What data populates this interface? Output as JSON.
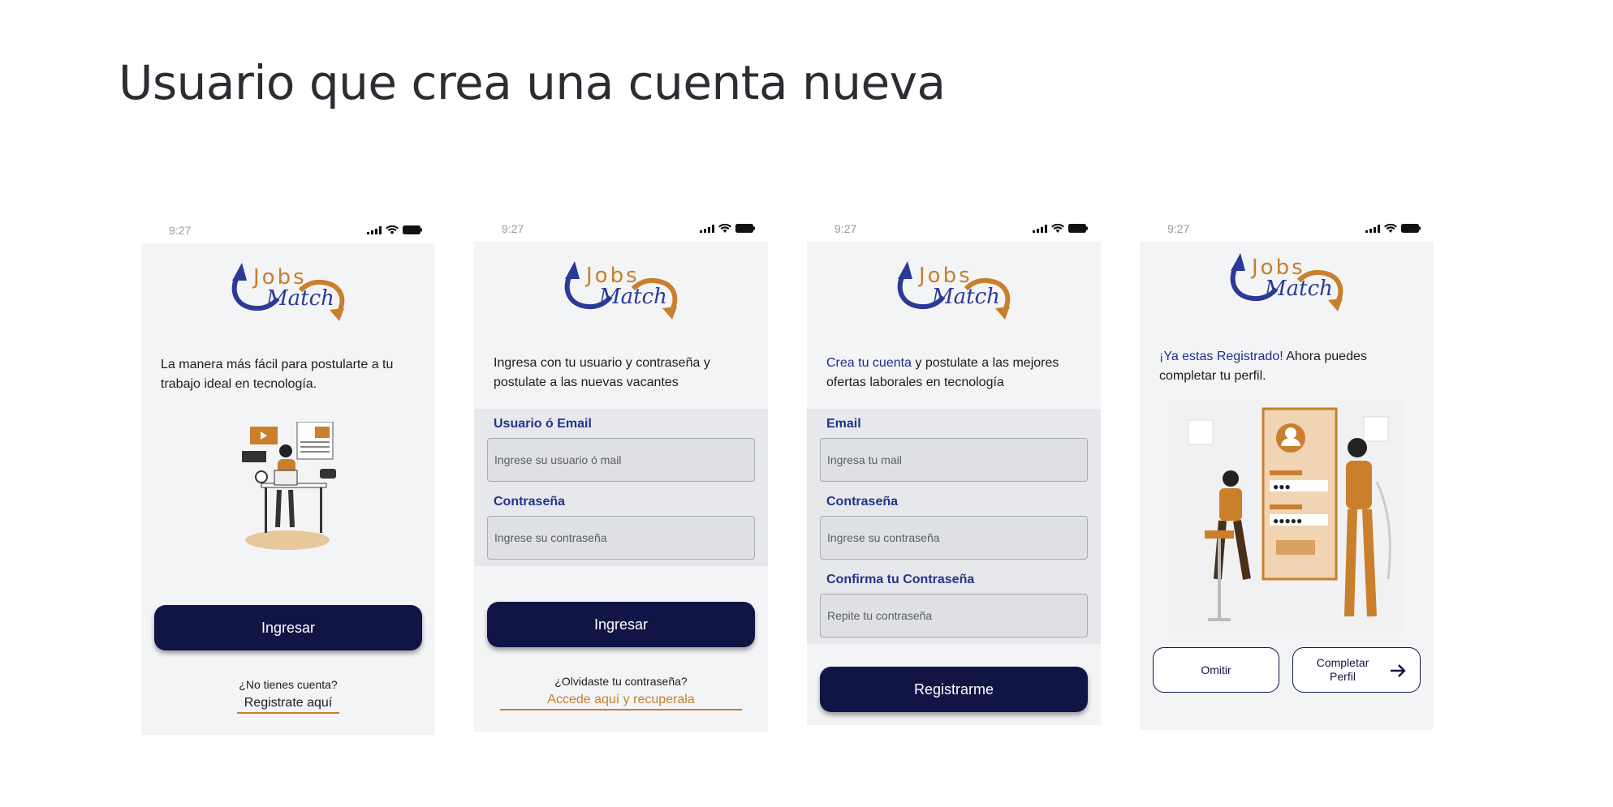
{
  "page": {
    "title": "Usuario que crea una cuenta nueva"
  },
  "screens": [
    {
      "time": "9:27",
      "intro": "La manera más fácil para postularte a tu trabajo ideal en tecnología.",
      "primary_button": "Ingresar",
      "question": "¿No tienes cuenta?",
      "link": "Registrate aquí"
    },
    {
      "time": "9:27",
      "intro": "Ingresa con tu usuario y contraseña y postulate a las nuevas vacantes",
      "fields": [
        {
          "label": "Usuario ó Email",
          "placeholder": "Ingrese su usuario ó mail"
        },
        {
          "label": "Contraseña",
          "placeholder": "Ingrese su contraseña"
        }
      ],
      "primary_button": "Ingresar",
      "question": "¿Olvidaste tu contraseña?",
      "link": "Accede aquí y recuperala"
    },
    {
      "time": "9:27",
      "intro_highlight": "Crea tu cuenta",
      "intro_rest": " y postulate a las mejores ofertas laborales en tecnología",
      "fields": [
        {
          "label": "Email",
          "placeholder": "Ingresa tu mail"
        },
        {
          "label": "Contraseña",
          "placeholder": "Ingrese su contraseña"
        },
        {
          "label": "Confirma tu Contraseña",
          "placeholder": "Repite tu contraseña"
        }
      ],
      "primary_button": "Registrarme"
    },
    {
      "time": "9:27",
      "intro_highlight": "¡Ya estas Registrado!",
      "intro_rest": " Ahora puedes completar tu perfil.",
      "skip_button": "Omitir",
      "complete_button": "Completar Perfil"
    }
  ],
  "logo": {
    "word1": "Jobs",
    "word2": "Match"
  },
  "colors": {
    "navy": "#111545",
    "accent": "#c97f2c",
    "blue": "#26338a",
    "screen_bg": "#f3f4f6"
  },
  "icons": [
    "signal-icon",
    "wifi-icon",
    "battery-icon",
    "arrow-right-icon"
  ]
}
